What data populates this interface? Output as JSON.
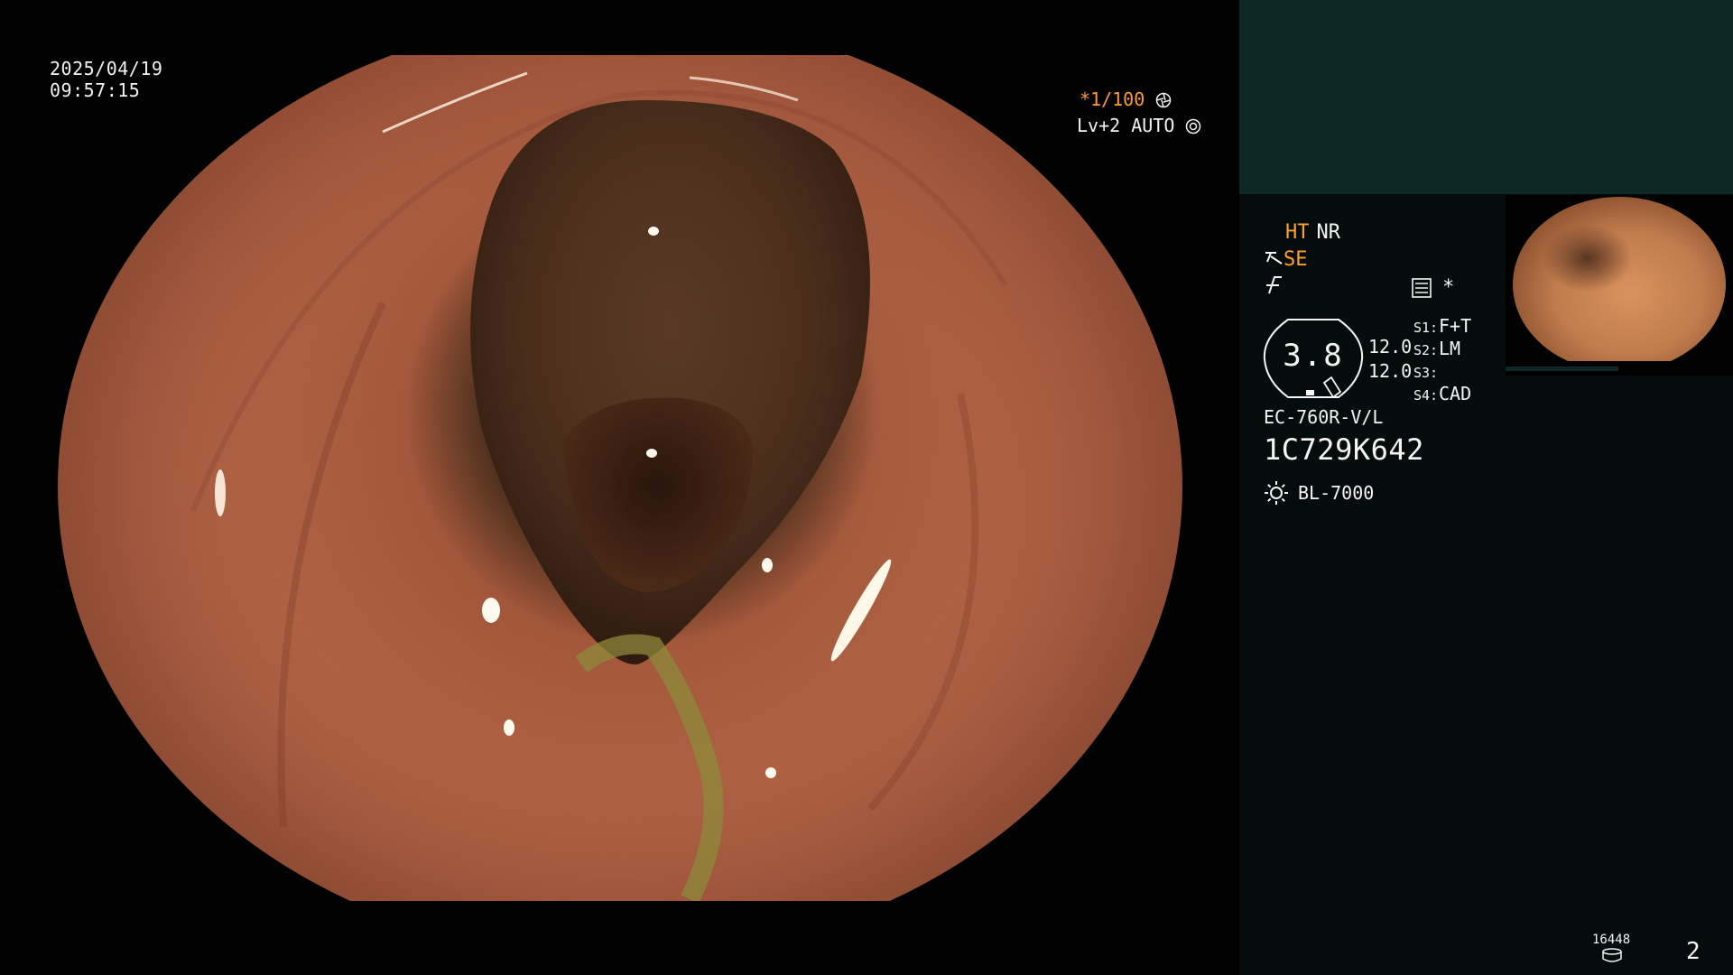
{
  "overlay": {
    "date": "2025/04/19",
    "time": "09:57:15",
    "shutter_speed": "*1/100",
    "level": "Lv+2 AUTO"
  },
  "panel": {
    "ht": "HT",
    "nr": "NR",
    "se": "SE",
    "star": "*",
    "gauge_value": "3.8",
    "num_a": "12.0",
    "num_b": "12.0",
    "s1_label": "S1:",
    "s1_value": "F+T",
    "s2_label": "S2:",
    "s2_value": "LM",
    "s3_label": "S3:",
    "s3_value": "",
    "s4_label": "S4:",
    "s4_value": "CAD",
    "scope_model": "EC-760R-V/L",
    "scope_serial": "1C729K642",
    "light_source": "BL-7000"
  },
  "footer": {
    "image_count": "16448",
    "page": "2"
  },
  "colors": {
    "accent_orange": "#ffa126",
    "panel_top": "#0d2826",
    "panel_bottom": "#050d0c",
    "text": "#f4f4f4"
  },
  "icons": [
    "shutter-icon",
    "auto-iris-icon",
    "structure-enhance-icon",
    "f-mode-icon",
    "menu-list-icon",
    "light-source-icon",
    "storage-disk-icon"
  ]
}
